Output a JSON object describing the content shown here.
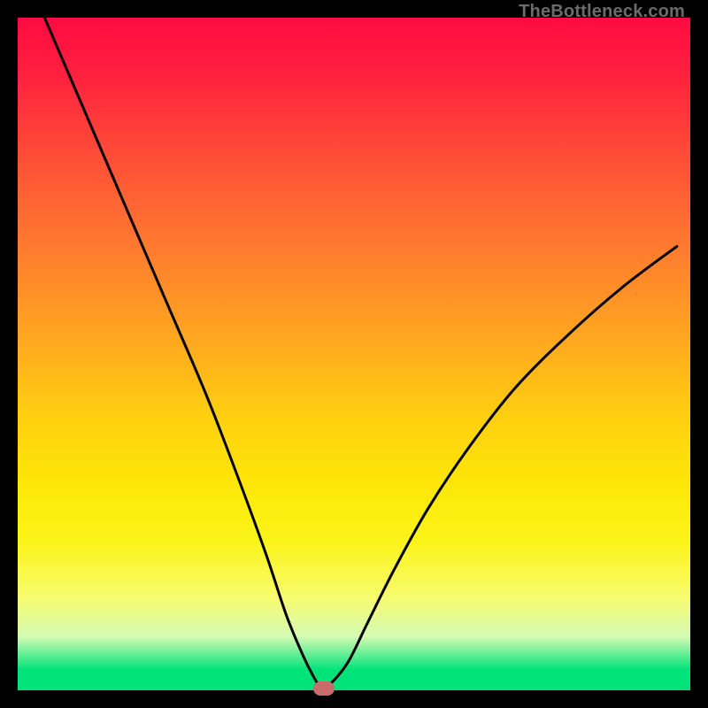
{
  "watermark": "TheBottleneck.com",
  "chart_data": {
    "type": "line",
    "title": "",
    "xlabel": "",
    "ylabel": "",
    "xlim": [
      0,
      100
    ],
    "ylim": [
      0,
      100
    ],
    "series": [
      {
        "name": "curve",
        "x": [
          4,
          10,
          16,
          22,
          28,
          33,
          37,
          40,
          42.5,
          44,
          45,
          46,
          49,
          52,
          56,
          61,
          67,
          74,
          82,
          90,
          98
        ],
        "y": [
          100,
          86,
          72,
          58,
          44,
          31,
          20,
          11,
          5,
          2,
          0.5,
          0.5,
          4,
          10,
          18,
          27,
          36,
          45,
          53,
          60,
          66
        ]
      }
    ],
    "marker": {
      "x": 45.5,
      "y": 0.3
    },
    "colors": {
      "gradient_top": "#ff0b42",
      "gradient_mid": "#ffd10f",
      "gradient_bottom": "#00e37a",
      "curve": "#000000",
      "marker": "#c86c6c"
    }
  }
}
